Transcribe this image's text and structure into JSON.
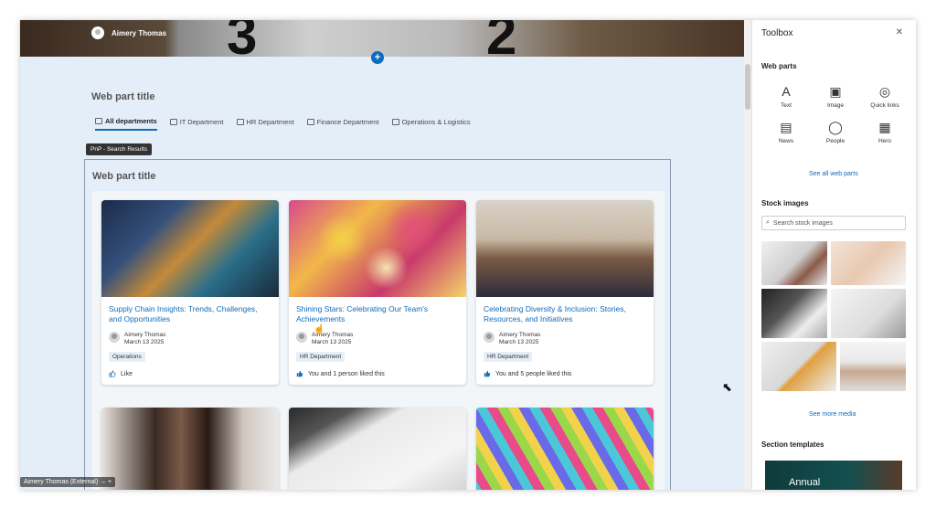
{
  "hero": {
    "user_name": "Aimery Thomas"
  },
  "section": {
    "web_part_title": "Web part title",
    "tabs": [
      {
        "label": "All departments"
      },
      {
        "label": "IT Department"
      },
      {
        "label": "HR Department"
      },
      {
        "label": "Finance Department"
      },
      {
        "label": "Operations & Logistics"
      }
    ],
    "pnp_tag": "PnP - Search Results",
    "inner_title": "Web part title"
  },
  "cards": [
    {
      "title": "Supply Chain Insights: Trends, Challenges, and Opportunities",
      "author": "Aimery Thomas",
      "date": "March 13 2025",
      "tag": "Operations",
      "likes": "Like"
    },
    {
      "title": "Shining Stars: Celebrating Our Team's Achievements",
      "author": "Aimery Thomas",
      "date": "March 13 2025",
      "tag": "HR Department",
      "likes": "You and 1 person liked this"
    },
    {
      "title": "Celebrating Diversity & Inclusion: Stories, Resources, and Initiatives",
      "author": "Aimery Thomas",
      "date": "March 13 2025",
      "tag": "HR Department",
      "likes": "You and 5 people liked this"
    }
  ],
  "toolbox": {
    "title": "Toolbox",
    "web_parts_heading": "Web parts",
    "web_parts": [
      {
        "label": "Text",
        "icon": "text-icon"
      },
      {
        "label": "Image",
        "icon": "image-icon"
      },
      {
        "label": "Quick links",
        "icon": "globe-icon"
      },
      {
        "label": "News",
        "icon": "news-icon"
      },
      {
        "label": "People",
        "icon": "person-icon"
      },
      {
        "label": "Hero",
        "icon": "hero-icon"
      }
    ],
    "see_all": "See all web parts",
    "stock_heading": "Stock images",
    "stock_placeholder": "Search stock images",
    "see_more": "See more media",
    "templates_heading": "Section templates",
    "template_label": "Annual"
  },
  "status": {
    "bottom_user": "Aimery Thomas (External)"
  }
}
